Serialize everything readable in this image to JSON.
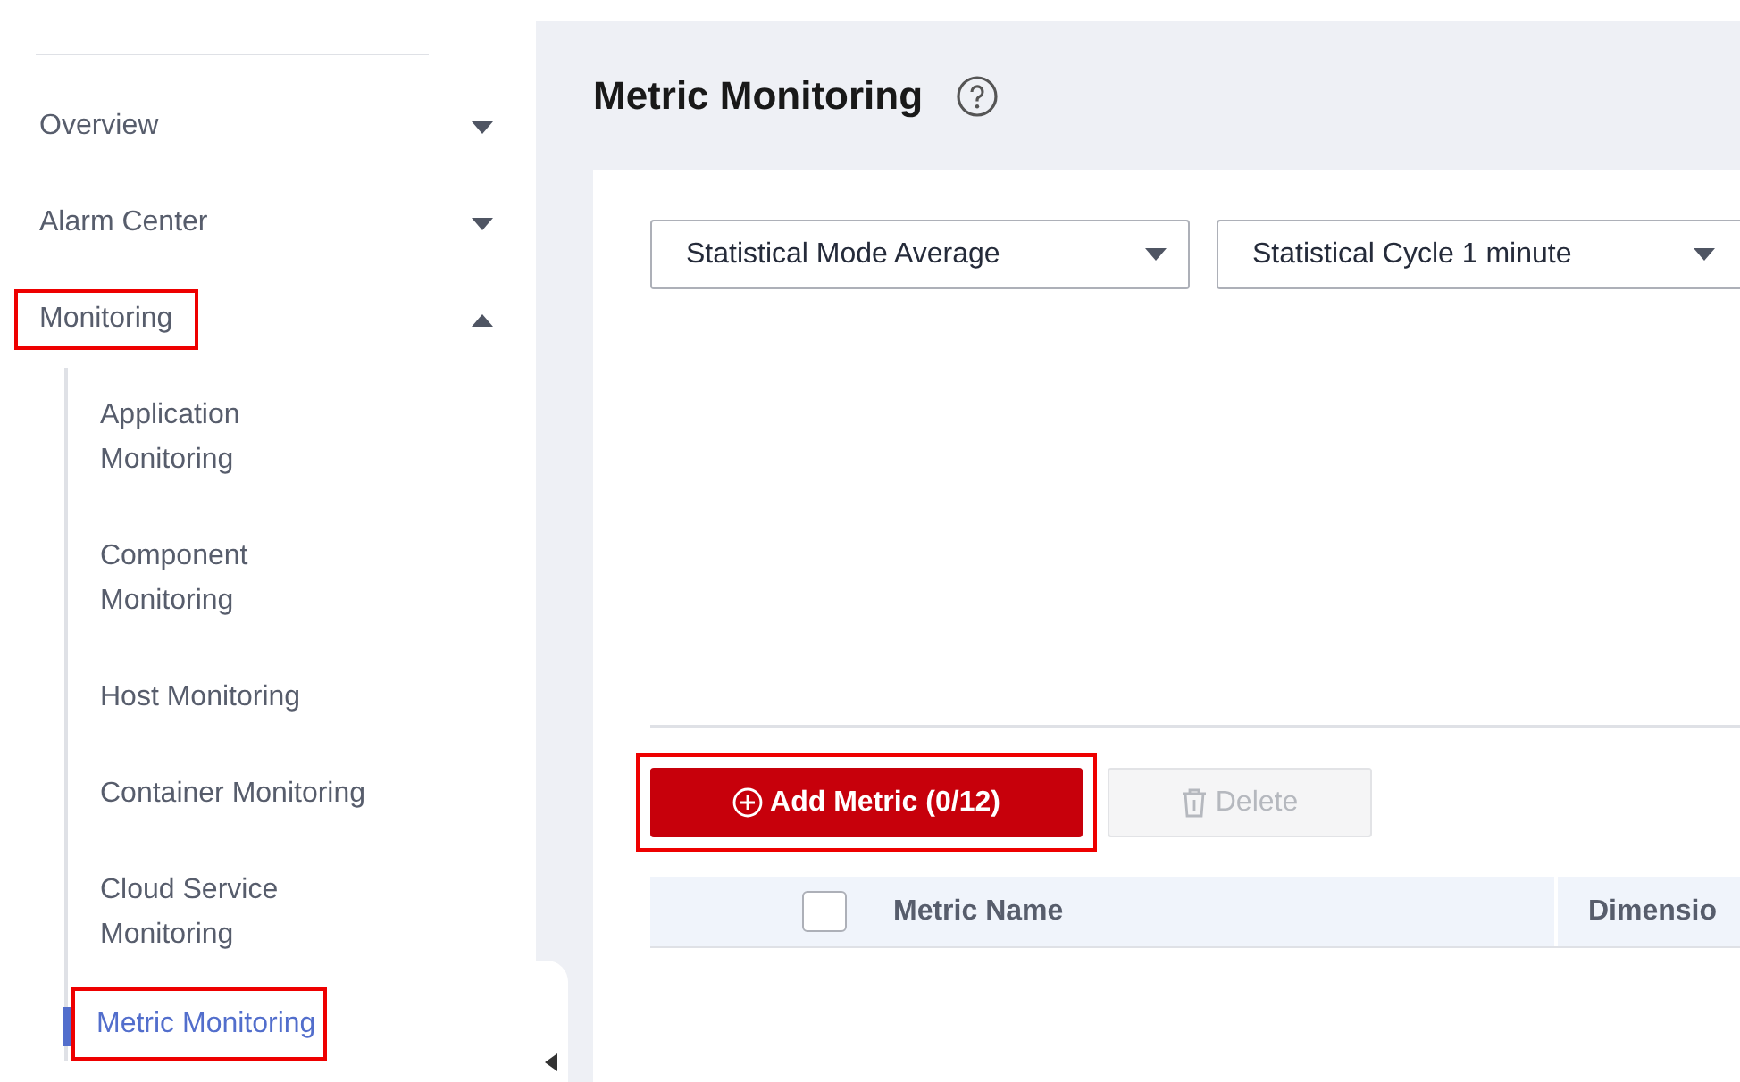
{
  "sidebar": {
    "items": [
      {
        "label": "Overview",
        "expanded": false,
        "highlighted": false
      },
      {
        "label": "Alarm Center",
        "expanded": false,
        "highlighted": false
      },
      {
        "label": "Monitoring",
        "expanded": true,
        "highlighted": true,
        "children": [
          {
            "label": "Application Monitoring",
            "selected": false,
            "highlighted": false
          },
          {
            "label": "Component Monitoring",
            "selected": false,
            "highlighted": false
          },
          {
            "label": "Host Monitoring",
            "selected": false,
            "highlighted": false
          },
          {
            "label": "Container Monitoring",
            "selected": false,
            "highlighted": false
          },
          {
            "label": "Cloud Service Monitoring",
            "selected": false,
            "highlighted": false
          },
          {
            "label": "Metric Monitoring",
            "selected": true,
            "highlighted": true
          }
        ]
      }
    ]
  },
  "page": {
    "title": "Metric Monitoring"
  },
  "filters": [
    {
      "label": "Statistical Mode",
      "value": "Average"
    },
    {
      "label": "Statistical Cycle",
      "value": "1 minute"
    }
  ],
  "buttons": [
    {
      "kind": "add",
      "label": "Add Metric (0/12)",
      "disabled": false,
      "highlighted": true
    },
    {
      "kind": "delete",
      "label": "Delete",
      "disabled": true,
      "highlighted": false
    }
  ],
  "table": {
    "select_all": {
      "checked": false
    },
    "columns": [
      "Metric Name",
      "Dimensio"
    ]
  }
}
